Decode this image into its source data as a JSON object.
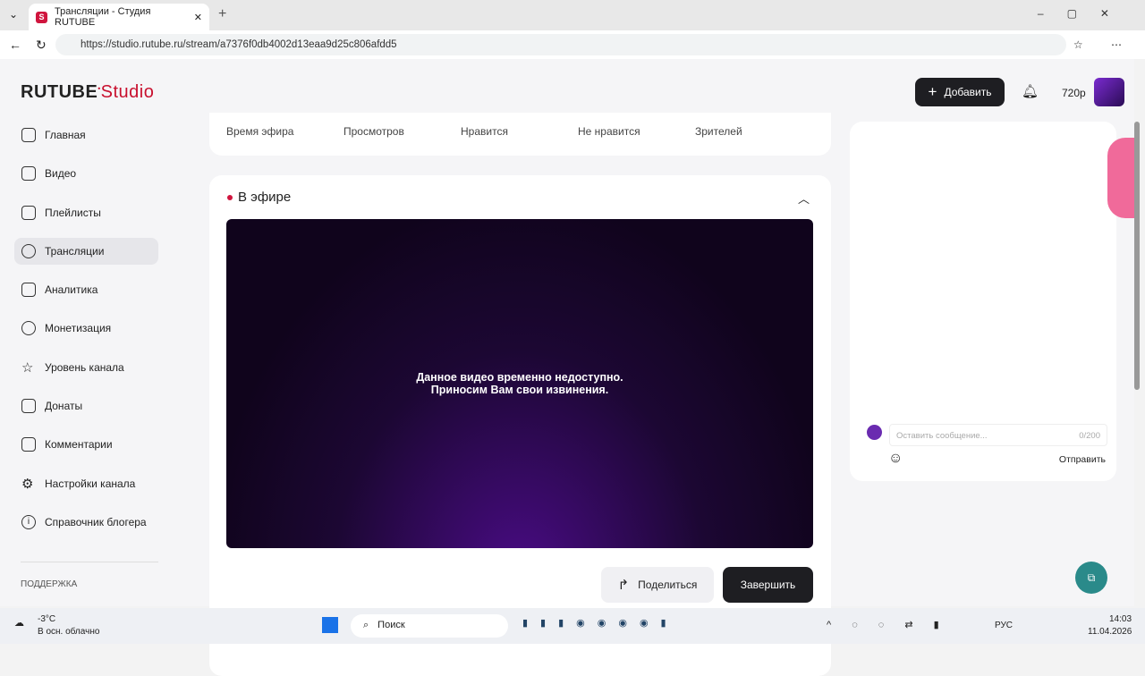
{
  "browser": {
    "tab_title": "Трансляции - Студия RUTUBE",
    "url": "https://studio.rutube.ru/stream/a7376f0db4002d13eaa9d25c806afdd5"
  },
  "logo": {
    "brand": "RUTUBE",
    "product": "Studio"
  },
  "header": {
    "add_label": "Добавить",
    "quality": "720p"
  },
  "nav": [
    "Главная",
    "Видео",
    "Плейлисты",
    "Трансляции",
    "Аналитика",
    "Монетизация",
    "Уровень канала",
    "Донаты",
    "Комментарии",
    "Настройки канала",
    "Справочник блогера"
  ],
  "support_label": "ПОДДЕРЖКА",
  "stats": [
    "Время эфира",
    "Просмотров",
    "Нравится",
    "Не нравится",
    "Зрителей"
  ],
  "live": {
    "title": "В эфире",
    "message1": "Данное видео временно недоступно.",
    "message2": "Приносим Вам свои извинения.",
    "share_label": "Поделиться",
    "finish_label": "Завершить"
  },
  "chat": {
    "placeholder": "Оставить сообщение...",
    "counter": "0/200",
    "send_label": "Отправить"
  },
  "taskbar": {
    "temp": "-3°C",
    "weather": "В осн. облачно",
    "search": "Поиск",
    "lang": "РУС",
    "time": "14:03",
    "date": "11.04.2026"
  }
}
